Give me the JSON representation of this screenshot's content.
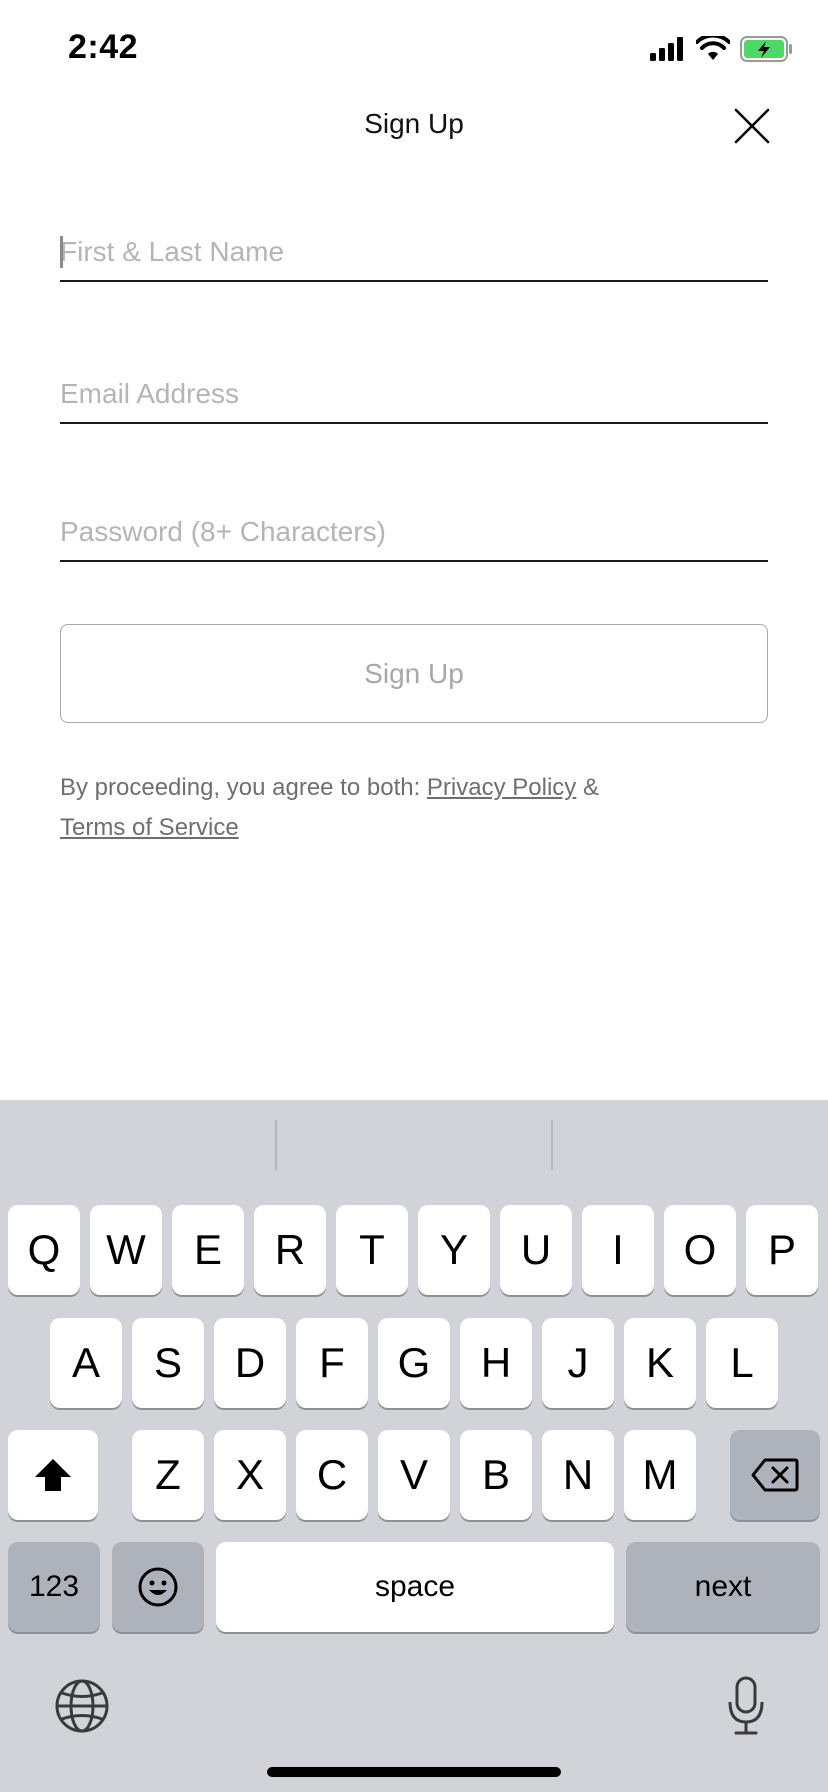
{
  "status_bar": {
    "time": "2:42",
    "icons": [
      "cellular-signal-icon",
      "wifi-icon",
      "battery-charging-icon"
    ],
    "battery_color": "#4cd964"
  },
  "header": {
    "title": "Sign Up",
    "close_icon": "close-icon"
  },
  "form": {
    "name_placeholder": "First & Last Name",
    "name_value": "",
    "email_placeholder": "Email Address",
    "email_value": "",
    "password_placeholder": "Password (8+ Characters)",
    "password_value": "",
    "submit_label": "Sign Up"
  },
  "legal": {
    "prefix": "By proceeding, you agree to both: ",
    "privacy_label": "Privacy Policy",
    "joiner": " &",
    "terms_label": "Terms of Service"
  },
  "keyboard": {
    "row1": [
      "Q",
      "W",
      "E",
      "R",
      "T",
      "Y",
      "U",
      "I",
      "O",
      "P"
    ],
    "row2": [
      "A",
      "S",
      "D",
      "F",
      "G",
      "H",
      "J",
      "K",
      "L"
    ],
    "row3": [
      "Z",
      "X",
      "C",
      "V",
      "B",
      "N",
      "M"
    ],
    "numbers_label": "123",
    "space_label": "space",
    "next_label": "next",
    "icons": [
      "shift-icon",
      "backspace-icon",
      "emoji-icon",
      "globe-icon",
      "microphone-icon"
    ]
  },
  "colors": {
    "keyboard_bg": "#d1d3d9",
    "placeholder": "#b5b5b5",
    "disabled_button": "#a8a8a8"
  }
}
